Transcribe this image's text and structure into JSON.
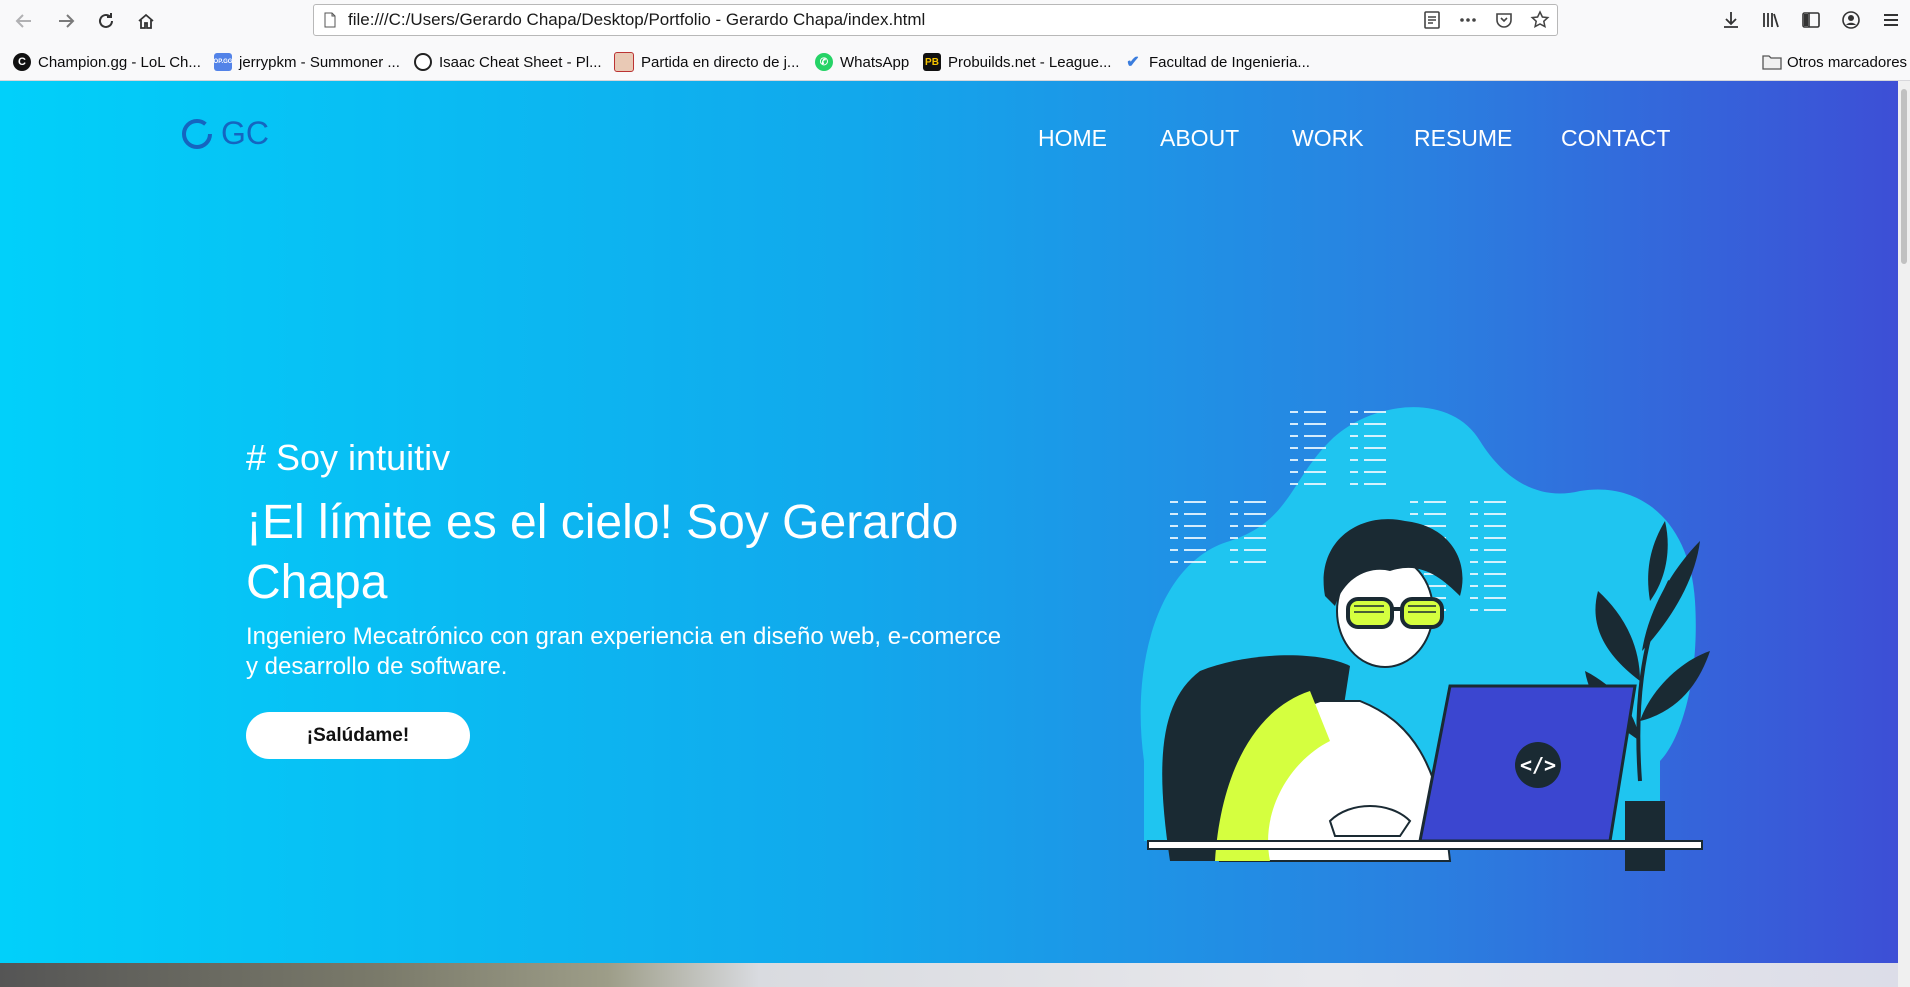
{
  "browser": {
    "url": "file:///C:/Users/Gerardo Chapa/Desktop/Portfolio - Gerardo Chapa/index.html",
    "bookmarks": [
      {
        "label": "Champion.gg - LoL Ch...",
        "icon": "champion-gg-favicon",
        "color": "#111111",
        "glyph": "C"
      },
      {
        "label": "jerrypkm - Summoner ...",
        "icon": "opgg-favicon",
        "color": "#5383e8",
        "glyph": "OP.GG"
      },
      {
        "label": "Isaac Cheat Sheet - Pl...",
        "icon": "isaac-favicon",
        "color": "#222222",
        "glyph": "●"
      },
      {
        "label": "Partida en directo de j...",
        "icon": "partida-favicon",
        "color": "#b33",
        "glyph": "◉"
      },
      {
        "label": "WhatsApp",
        "icon": "whatsapp-favicon",
        "color": "#25d366",
        "glyph": "✆"
      },
      {
        "label": "Probuilds.net - League...",
        "icon": "probuilds-favicon",
        "color": "#111111",
        "glyph": "PB"
      },
      {
        "label": "Facultad de Ingenieria...",
        "icon": "check-favicon",
        "color": "#3b7ddd",
        "glyph": "✔"
      }
    ],
    "other_bookmarks": "Otros marcadores"
  },
  "site": {
    "logo_text": "GC",
    "nav": [
      "HOME",
      "ABOUT",
      "WORK",
      "RESUME",
      "CONTACT"
    ],
    "tagline": "# Soy intuitiv",
    "headline": "¡El límite es el cielo! Soy Gerardo Chapa",
    "subtitle": "Ingeniero Mecatrónico con gran experiencia en diseño web, e-comerce y desarrollo de software.",
    "cta": "¡Salúdame!",
    "code_icon_text": "</>"
  },
  "colors": {
    "gradient_start": "#01d0fa",
    "gradient_end": "#3d4fd6",
    "logo": "#1565c0",
    "accent_lime": "#d5ff3f",
    "laptop": "#3b46d0"
  }
}
